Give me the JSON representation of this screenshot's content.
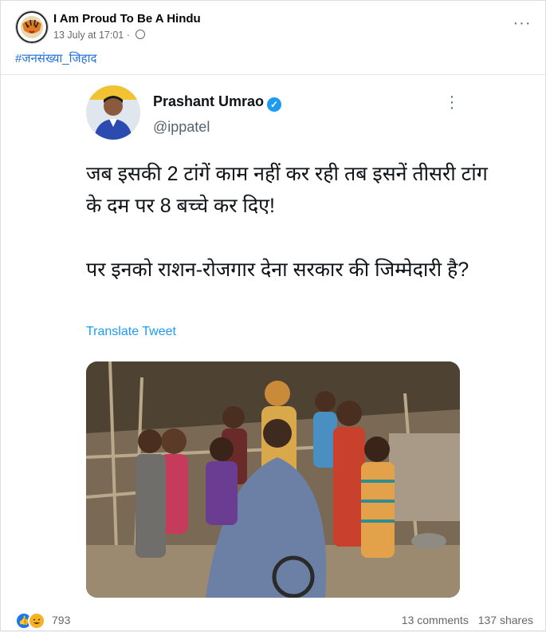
{
  "post": {
    "page_name": "I Am Proud To Be A Hindu",
    "timestamp": "13 July at 17:01",
    "separator": "·",
    "hashtag": "#जनसंख्या_जिहाद",
    "more_icon": "more-horizontal-icon"
  },
  "tweet": {
    "author_name": "Prashant Umrao",
    "handle": "@ippatel",
    "text_line1": "जब इसकी 2 टांगें काम नहीं कर रही तब इसनें तीसरी टांग के दम पर 8 बच्चे कर दिए!",
    "text_line2": "पर इनको राशन-रोजगार देना सरकार की जिम्मेदारी है?",
    "translate_label": "Translate Tweet",
    "verified_icon": "verified-badge-icon"
  },
  "footer": {
    "reaction_count": "793",
    "comments": "13 comments",
    "shares": "137 shares"
  },
  "colors": {
    "link_blue": "#216fdb",
    "twitter_blue": "#1d9bf0",
    "meta_gray": "#65676b"
  }
}
